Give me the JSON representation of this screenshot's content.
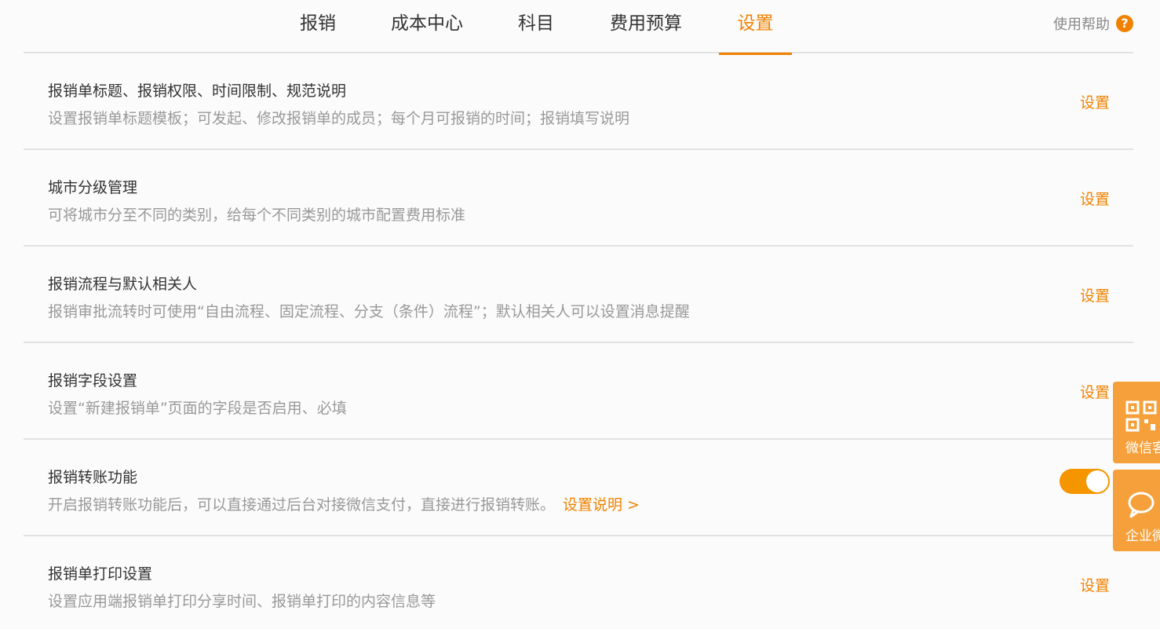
{
  "nav": {
    "tabs": [
      {
        "label": "报销"
      },
      {
        "label": "成本中心"
      },
      {
        "label": "科目"
      },
      {
        "label": "费用预算"
      },
      {
        "label": "设置"
      }
    ],
    "active_tab": "设置",
    "help_label": "使用帮助",
    "help_icon": "question-circle-icon"
  },
  "rows": [
    {
      "title": "报销单标题、报销权限、时间限制、规范说明",
      "desc": "设置报销单标题模板；可发起、修改报销单的成员；每个月可报销的时间；报销填写说明",
      "action": "设置"
    },
    {
      "title": "城市分级管理",
      "desc": "可将城市分至不同的类别，给每个不同类别的城市配置费用标准",
      "action": "设置"
    },
    {
      "title": "报销流程与默认相关人",
      "desc": "报销审批流转时可使用“自由流程、固定流程、分支（条件）流程”；默认相关人可以设置消息提醒",
      "action": "设置"
    },
    {
      "title": "报销字段设置",
      "desc": "设置“新建报销单”页面的字段是否启用、必填",
      "action": "设置"
    },
    {
      "title": "报销转账功能",
      "desc": "开启报销转账功能后，可以直接通过后台对接微信支付，直接进行报销转账。",
      "link": "设置说明 >",
      "toggle_on": true
    },
    {
      "title": "报销单打印设置",
      "desc": "设置应用端报销单打印分享时间、报销单打印的内容信息等",
      "action": "设置"
    }
  ],
  "float": {
    "items": [
      {
        "label": "微信客",
        "icon": "qr-code-icon"
      },
      {
        "label": "企业微",
        "icon": "chat-bubble-icon"
      }
    ]
  },
  "colors": {
    "accent": "#f08200",
    "toggle": "#f59500",
    "float_bg": "#f5a03a"
  }
}
